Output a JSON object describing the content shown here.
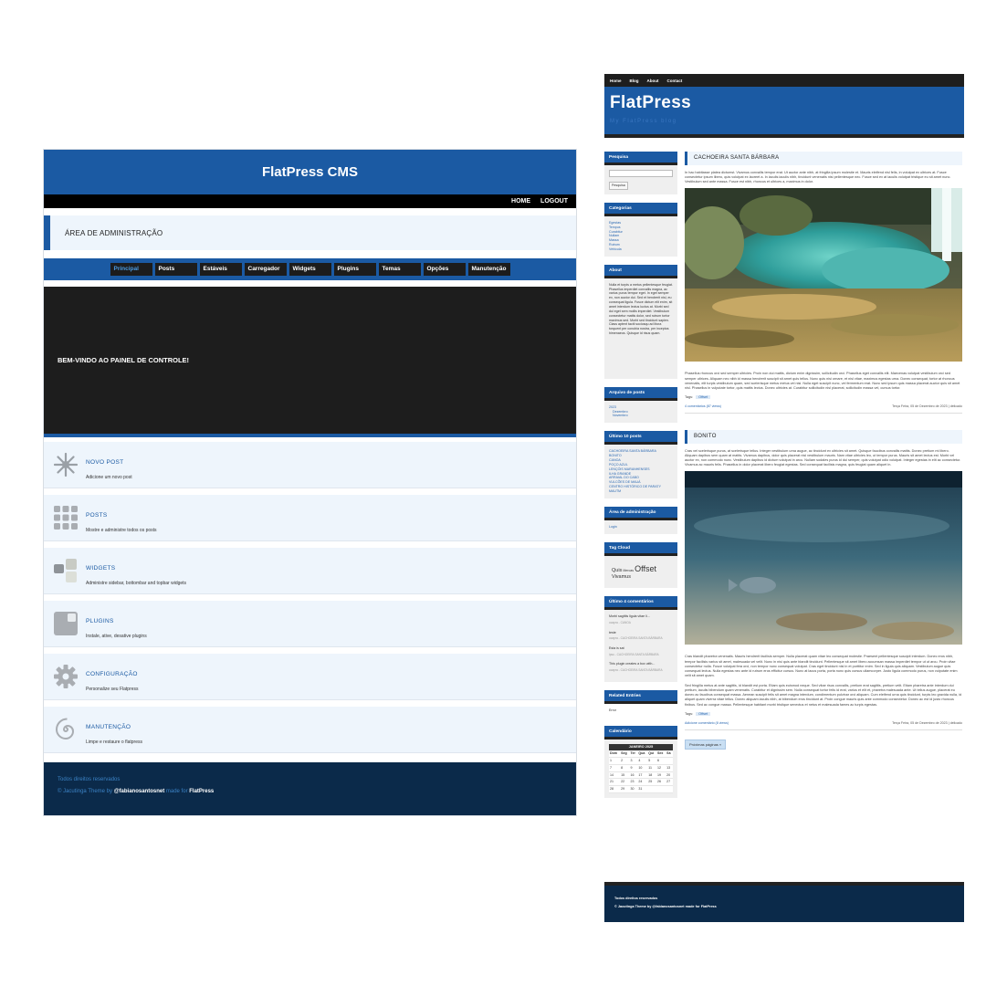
{
  "admin": {
    "title": "FlatPress CMS",
    "topnav": [
      "HOME",
      "LOGOUT"
    ],
    "area_title": "ÁREA DE ADMINISTRAÇÃO",
    "tabs": [
      "Principal",
      "Posts",
      "Estáveis",
      "Carregador",
      "Widgets",
      "Plugins",
      "Temas",
      "Opções",
      "Manutenção"
    ],
    "active_tab": "Principal",
    "welcome": "BEM-VINDO AO PAINEL DE CONTROLE!",
    "items": [
      {
        "title": "NOVO POST",
        "desc": "Adicione um novo post",
        "icon": "starburst-icon"
      },
      {
        "title": "POSTS",
        "desc": "Mostre e administre todos os posts",
        "icon": "grid-icon"
      },
      {
        "title": "WIDGETS",
        "desc": "Administre sidebar, bottombar and topbar widgets",
        "icon": "widgets-icon"
      },
      {
        "title": "PLUGINS",
        "desc": "Instale, ative, desative plugins",
        "icon": "plugin-icon"
      },
      {
        "title": "CONFIGURAÇÃO",
        "desc": "Personalize seu Flatpress",
        "icon": "gear-icon"
      },
      {
        "title": "MANUTENÇÃO",
        "desc": "Limpe e restaure o flatpress",
        "icon": "spiral-icon"
      }
    ],
    "footer": {
      "line1": "Todos direitos reservados",
      "line2_prefix": "© Jacutinga Theme by ",
      "line2_author": "@fabianosantosnet",
      "line2_mid": " made for ",
      "line2_brand": "FlatPress"
    }
  },
  "blog": {
    "nav": [
      "Home",
      "Blog",
      "About",
      "Contact"
    ],
    "logo": "FlatPress",
    "tagline": "My FlatPress blog",
    "widgets": {
      "search": {
        "title": "Pesquisa",
        "button": "Pesquisa"
      },
      "categories": {
        "title": "Categorias",
        "items": [
          "Egestas",
          "Tempus",
          "Curabitur",
          "Nullam",
          "Massa",
          "Rutrum",
          "Vehicula"
        ]
      },
      "about": {
        "title": "About",
        "text": "Nulla et turpis a metus pellentesque feugiat. Phasellus imperdiet convallis magna, ac varius purus tempor eget. In eget semper ex, non auctor dui. Sed et hendrerit nisl, eu consequat ligula. Fusce dictum elit enim, sit amet interdum lectus luctus at. Morbi sed dui eget sem mollis imperdiet. Vestibulum consectetur mattis dolor, sed rutrum tortor maximus sed. Morbi sed tincidunt sapien. Class aptent taciti sociosqu ad litora torquent per conubia nostra, per inceptos himenaeos. Quisque id risus quam."
      },
      "archive": {
        "title": "Arquivo de posts",
        "year": "2023",
        "months": [
          "Dezembro",
          "Novembro"
        ]
      },
      "latest": {
        "title": "Último 10 posts",
        "items": [
          "CACHOEIRA SANTA BÁRBARA",
          "BONITO",
          "CANOA",
          "POÇO AZUL",
          "LENÇÓIS MARANHENSES",
          "ILHA GRANDE",
          "ARRAIAL DO CABO",
          "VULCÕES DE MAUÁ",
          "CENTRO HISTÓRICO DE PARATY",
          "MAUTM"
        ]
      },
      "admin": {
        "title": "Área de administração",
        "link": "Login"
      },
      "tagcloud": {
        "title": "Tag Cloud",
        "tags": [
          "Quis",
          "Mercas",
          "Offset",
          "Vivamus"
        ]
      },
      "comments": {
        "title": "Último 4 comentários",
        "items": [
          {
            "text": "Morbi sagittis ligula vitae li...",
            "by": "ocapra - CANOA"
          },
          {
            "text": "teste",
            "by": "ocapra - CACHOEIRA SANTA BÁRBARA"
          },
          {
            "text": "Esta is sat",
            "by": "ipsu - CACHOEIRA SANTA BÁRBARA"
          },
          {
            "text": "This plugin creates a box with...",
            "by": "ocapra - CACHOEIRA SANTA BÁRBARA"
          }
        ]
      },
      "related": {
        "title": "Related Entries",
        "text": "Error"
      },
      "calendar": {
        "title": "Calendário",
        "month": "JANEIRO 2025",
        "days": [
          "Dom",
          "Seg",
          "Ter",
          "Qua",
          "Qui",
          "Sex",
          "Sá"
        ],
        "weeks": [
          [
            "1",
            "2",
            "3",
            "4",
            "5",
            "6",
            ""
          ],
          [
            "7",
            "8",
            "9",
            "10",
            "11",
            "12",
            "13"
          ],
          [
            "14",
            "15",
            "16",
            "17",
            "18",
            "19",
            "20"
          ],
          [
            "21",
            "22",
            "23",
            "24",
            "25",
            "26",
            "27"
          ],
          [
            "28",
            "29",
            "30",
            "31",
            "",
            "",
            ""
          ]
        ]
      }
    },
    "posts": [
      {
        "title": "CACHOEIRA SANTA BÁRBARA",
        "intro": "In hac habitasse platea dictumst. Vivamus convallis tempor erat. Ut auctor ante nibh, at fringilla ipsum molestie et. Mauris eleifend nisl felis, in volutpat ex ultrices at. Fusce consectetur ipsum libero, quis volutpat ex laoreet a. In iaculis iaculis nibh, tincidunt venenatis nisi pellentesque nec. Fusce sed ex at iaculis volutpat tristique eu sit amet nunc. Vestibulum sed ante massa. Fusce est nibh, rhoncus et ultrices a, maximus in dolor.",
        "body": "Phasellus rhoncus orci sed semper ultricies. Proin non dui mattis, dictum enim dignissim, sollicitudin orci. Phasellus eget convallis elit. Maecenas volutpat vestibulum orci sed semper ultrices. Aliquam nec nibh id massa hendrerit suscipit sit amet quis tellus. Nunc quis nisi ornare, et nisl vitae, maximus egestas urna. Donec consequat, tortor at rhoncus venenatis, elit turpis vestibulum quam, sed scelerisque metus metus vel nisi. Nulla eget suscipit nunc, vel fermentum erat. Nunc sed ipsum quis massa placerat auctor quis sit amet nisl. Phasellus in vulputate tortor, quis mattis lectus. Donec ultricies at. Curabitur sollicitudin nisl placerat, sollicitudin massa vel, cursus tortor.",
        "tag": "Offset",
        "comments": "4 comentários (87 views)",
        "date": "Terça Feira, 05 de Dezembro de 2023 | delicado"
      },
      {
        "title": "BONITO",
        "intro": "Cras vel scelerisque purus, at scelerisque tellus. Integer vestibulum urna augue, ac tincidunt ex ultricies sit amet. Quisque faucibus convallis mattis. Donec pretium mi libero. Aliquam dapibus sem quam at mattis. Vivamus dapibus, dolor quis placerat nisl vestibulum mauris. Nam vitae ultricies leo, ut tempor purus. Mauris sit amet lectus est. Morbi vel auctor ex, non commodo nunc. Vestibulum dapibus id dictum volutpat in arcu. Nullam sodales purus id dui semper, quis volutpat odio volutpat. Integer egestas in elit ac consectetur. Vivamus ac mauris felis. Phasellus in dolor placerat libero feugiat egestas. Sed consequat facilisis magna, quis feugiat quam aliquet in.",
        "body": "Cras blandit pharetra venenatis. Mauris hendrerit facilisis semper. Nulla placerat quam vitae leo consequat molestie. Praesent pellentesque suscipit interdum. Donec eros nibh, tempor facilisis varius sit amet, malesuada vel velit. Nunc in nisi quis ante blandit tincidunt. Pellentesque sit amet libero accumsan massa imperdiet tempor ut ut arcu. Proin vitae consectetur nulla. Fusce volutpat fera orci, non tempor nunc consequat volutpat. Cras eget tincidunt nisl in et porttitor enim. Sed in ligula quis aliquam. Vestibulum augue quis consequat lectus. Nulla egestas nec ante id rutrum eros efficitur cursus. Nunc at lacus porta, porta nunc quis cursus ullamcorper. Justo ligula commodo purus, non vulputate enim velit sit amet quam.",
        "body2": "Sed fringilla metus at ante sagittis, id blandit est porta. Etiam quis euismod neque. Sed vitae risus convallis, pretium erat sagittis, pretium velit. Etiam pharetra ante interdum dui pretium, iaculis bibendum quam venenatis. Curabitur et dignissim sem. Nulla consequat tortor felis id erat, varius et elit et, pharetra malesuada ante. Ut tellus augue, placerat eu donec ac faucibus consequat massa. Aenean suscipit felis sit amet magna interdum, condimentum pulvinar orci aliquam. Cum eleifend urna quis tincidunt, turpis leo gravida nulla, id aliquet quam viverra vitae tellus. Donec aliquam iaculis nibh, at bibendum eros tincidunt at. Proin congue mauris quis ante commodo consectetur. Donec ac est id justo rhoncus finibus. Sed ac congue massa. Pellentesque habitant morbi tristique senectus et netus et malesuada fames ac turpis egestas.",
        "tag": "Offset",
        "comments": "Adicione comentário (8 views)",
        "date": "Terça Feira, 05 de Dezembro de 2023 | delicado"
      }
    ],
    "next": "Próximas páginas »",
    "footer": {
      "line1": "Todos direitos reservados",
      "line2": "© Jacutinga Theme by @fabianosantosnet made for FlatPress"
    }
  }
}
